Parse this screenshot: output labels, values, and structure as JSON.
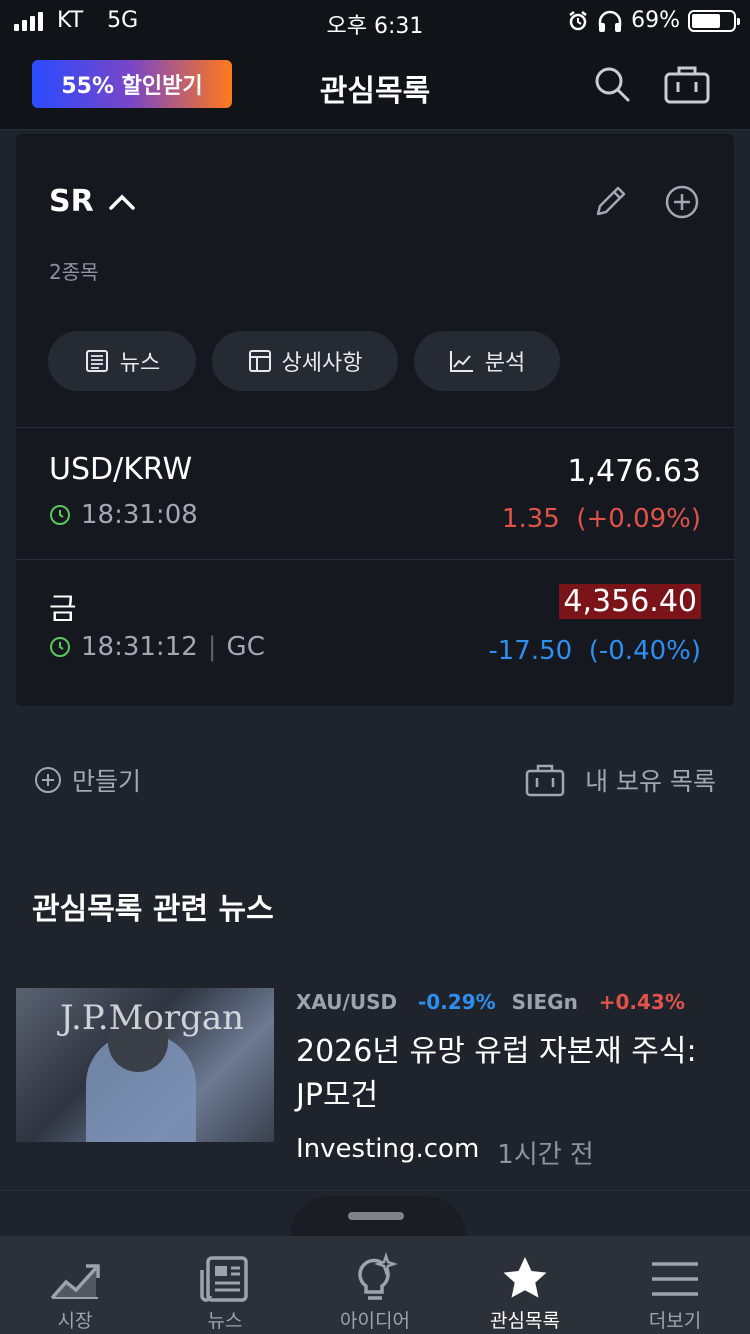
{
  "status_bar": {
    "carrier": "KT",
    "network": "5G",
    "time": "오후 6:31",
    "battery": "69%"
  },
  "header": {
    "promo_label": "55% 할인받기",
    "title": "관심목록"
  },
  "watchlist": {
    "name": "SR",
    "count_label": "2종목",
    "pills": [
      {
        "label": "뉴스",
        "icon": "newspaper-icon"
      },
      {
        "label": "상세사항",
        "icon": "table-icon"
      },
      {
        "label": "분석",
        "icon": "chart-icon"
      }
    ],
    "items": [
      {
        "symbol": "USD/KRW",
        "time": "18:31:08",
        "exchange": "",
        "price": "1,476.63",
        "change": "1.35",
        "change_pct": "(+0.09%)",
        "direction": "up"
      },
      {
        "symbol": "금",
        "time": "18:31:12",
        "exchange": "GC",
        "price": "4,356.40",
        "change": "-17.50",
        "change_pct": "(-0.40%)",
        "direction": "down"
      }
    ]
  },
  "actions": {
    "create_label": "만들기",
    "holdings_label": "내 보유 목록"
  },
  "news": {
    "section_title": "관심목록 관련 뉴스",
    "articles": [
      {
        "thumb_logo": "J.P.Morgan",
        "tags": [
          {
            "symbol": "XAU/USD",
            "change": "-0.29%",
            "direction": "down"
          },
          {
            "symbol": "SIEGn",
            "change": "+0.43%",
            "direction": "up"
          }
        ],
        "headline": "2026년 유망 유럽 자본재 주식: JP모건",
        "source": "Investing.com",
        "ago": "1시간 전"
      }
    ]
  },
  "tabbar": [
    {
      "label": "시장",
      "icon": "market-chart-icon",
      "active": false
    },
    {
      "label": "뉴스",
      "icon": "news-icon",
      "active": false
    },
    {
      "label": "아이디어",
      "icon": "lightbulb-icon",
      "active": false
    },
    {
      "label": "관심목록",
      "icon": "star-icon",
      "active": true
    },
    {
      "label": "더보기",
      "icon": "menu-icon",
      "active": false
    }
  ],
  "colors": {
    "up": "#e0534b",
    "down": "#2d8ff0",
    "background": "#1f232b",
    "card": "#15181e"
  }
}
